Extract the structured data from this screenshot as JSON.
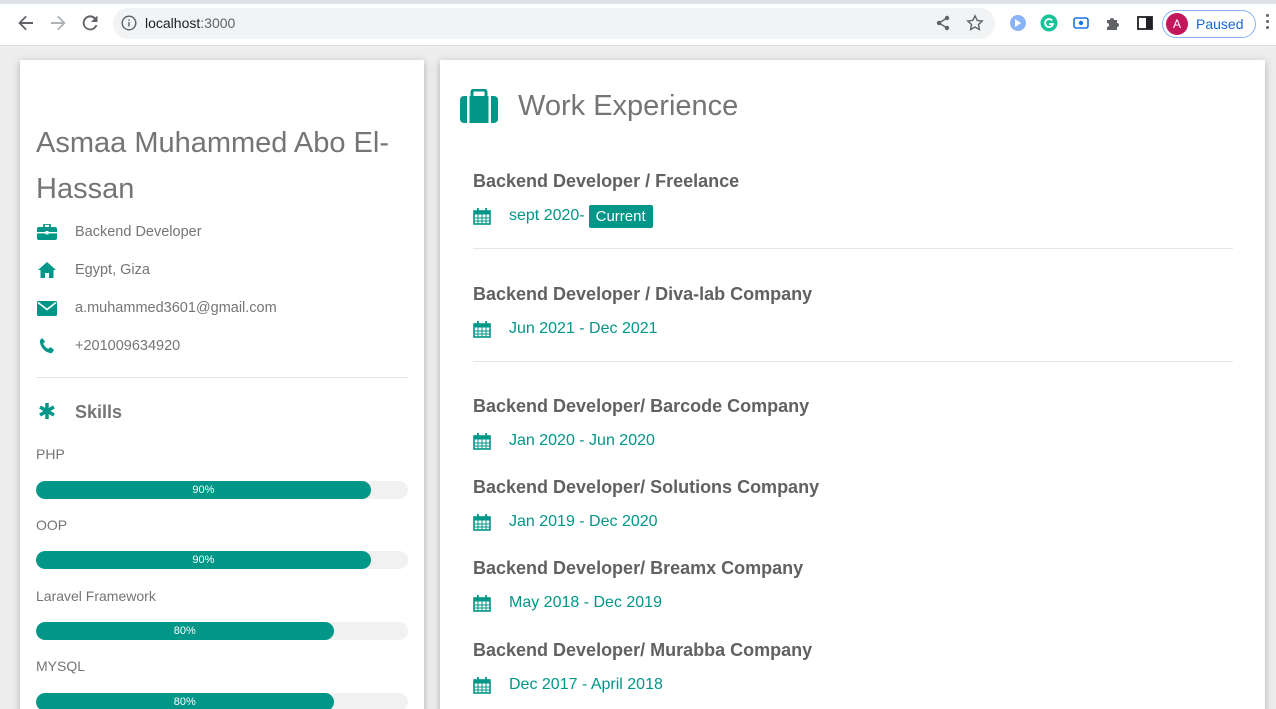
{
  "browser": {
    "url_host": "localhost",
    "url_port": ":3000",
    "profile_initial": "A",
    "profile_status": "Paused"
  },
  "profile": {
    "name": "Asmaa Muhammed Abo El-Hassan",
    "job": "Backend Developer",
    "location": "Egypt, Giza",
    "email": "a.muhammed3601@gmail.com",
    "phone": "+201009634920"
  },
  "skills": {
    "heading": "Skills",
    "items": [
      {
        "name": "PHP",
        "percent": 90,
        "label": "90%"
      },
      {
        "name": "OOP",
        "percent": 90,
        "label": "90%"
      },
      {
        "name": "Laravel Framework",
        "percent": 80,
        "label": "80%"
      },
      {
        "name": "MYSQL",
        "percent": 80,
        "label": "80%"
      }
    ]
  },
  "work": {
    "heading": "Work Experience",
    "jobs": [
      {
        "title": "Backend Developer / Freelance",
        "date": "sept 2020-",
        "badge": "Current"
      },
      {
        "title": "Backend Developer / Diva-lab Company",
        "date": "Jun 2021 - Dec 2021"
      },
      {
        "title": "Backend Developer/ Barcode Company",
        "date": "Jan 2020 - Jun 2020"
      },
      {
        "title": "Backend Developer/ Solutions Company",
        "date": "Jan 2019 - Dec 2020"
      },
      {
        "title": "Backend Developer/ Breamx Company",
        "date": "May 2018 - Dec 2019"
      },
      {
        "title": "Backend Developer/ Murabba Company",
        "date": "Dec 2017 - April 2018"
      }
    ]
  },
  "colors": {
    "accent": "#009688",
    "text": "#757575"
  }
}
